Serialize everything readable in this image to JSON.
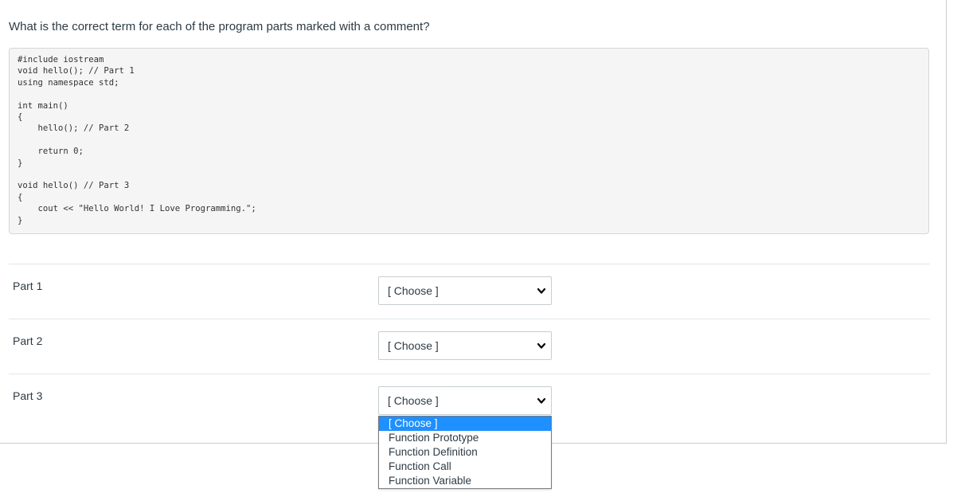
{
  "question": {
    "text": "What is the correct term for each of the program parts marked with a comment?"
  },
  "code": {
    "lines": [
      "#include iostream",
      "void hello(); // Part 1",
      "using namespace std;",
      "",
      "int main()",
      "{",
      "    hello(); // Part 2",
      "",
      "    return 0;",
      "}",
      "",
      "void hello() // Part 3",
      "{",
      "    cout << \"Hello World! I Love Programming.\";",
      "}"
    ]
  },
  "answers": [
    {
      "label": "Part 1",
      "selected": "[ Choose ]"
    },
    {
      "label": "Part 2",
      "selected": "[ Choose ]"
    },
    {
      "label": "Part 3",
      "selected": "[ Choose ]"
    }
  ],
  "dropdown": {
    "open_for": "Part 3",
    "highlighted_index": 0,
    "options": [
      "[ Choose ]",
      "Function Prototype",
      "Function Definition",
      "Function Call",
      "Function Variable"
    ]
  },
  "icons": {
    "select_arrow": "chevron-down-icon"
  },
  "colors": {
    "highlight": "#1e90ff",
    "text": "#2d3b45",
    "code_background": "#f5f5f5"
  }
}
